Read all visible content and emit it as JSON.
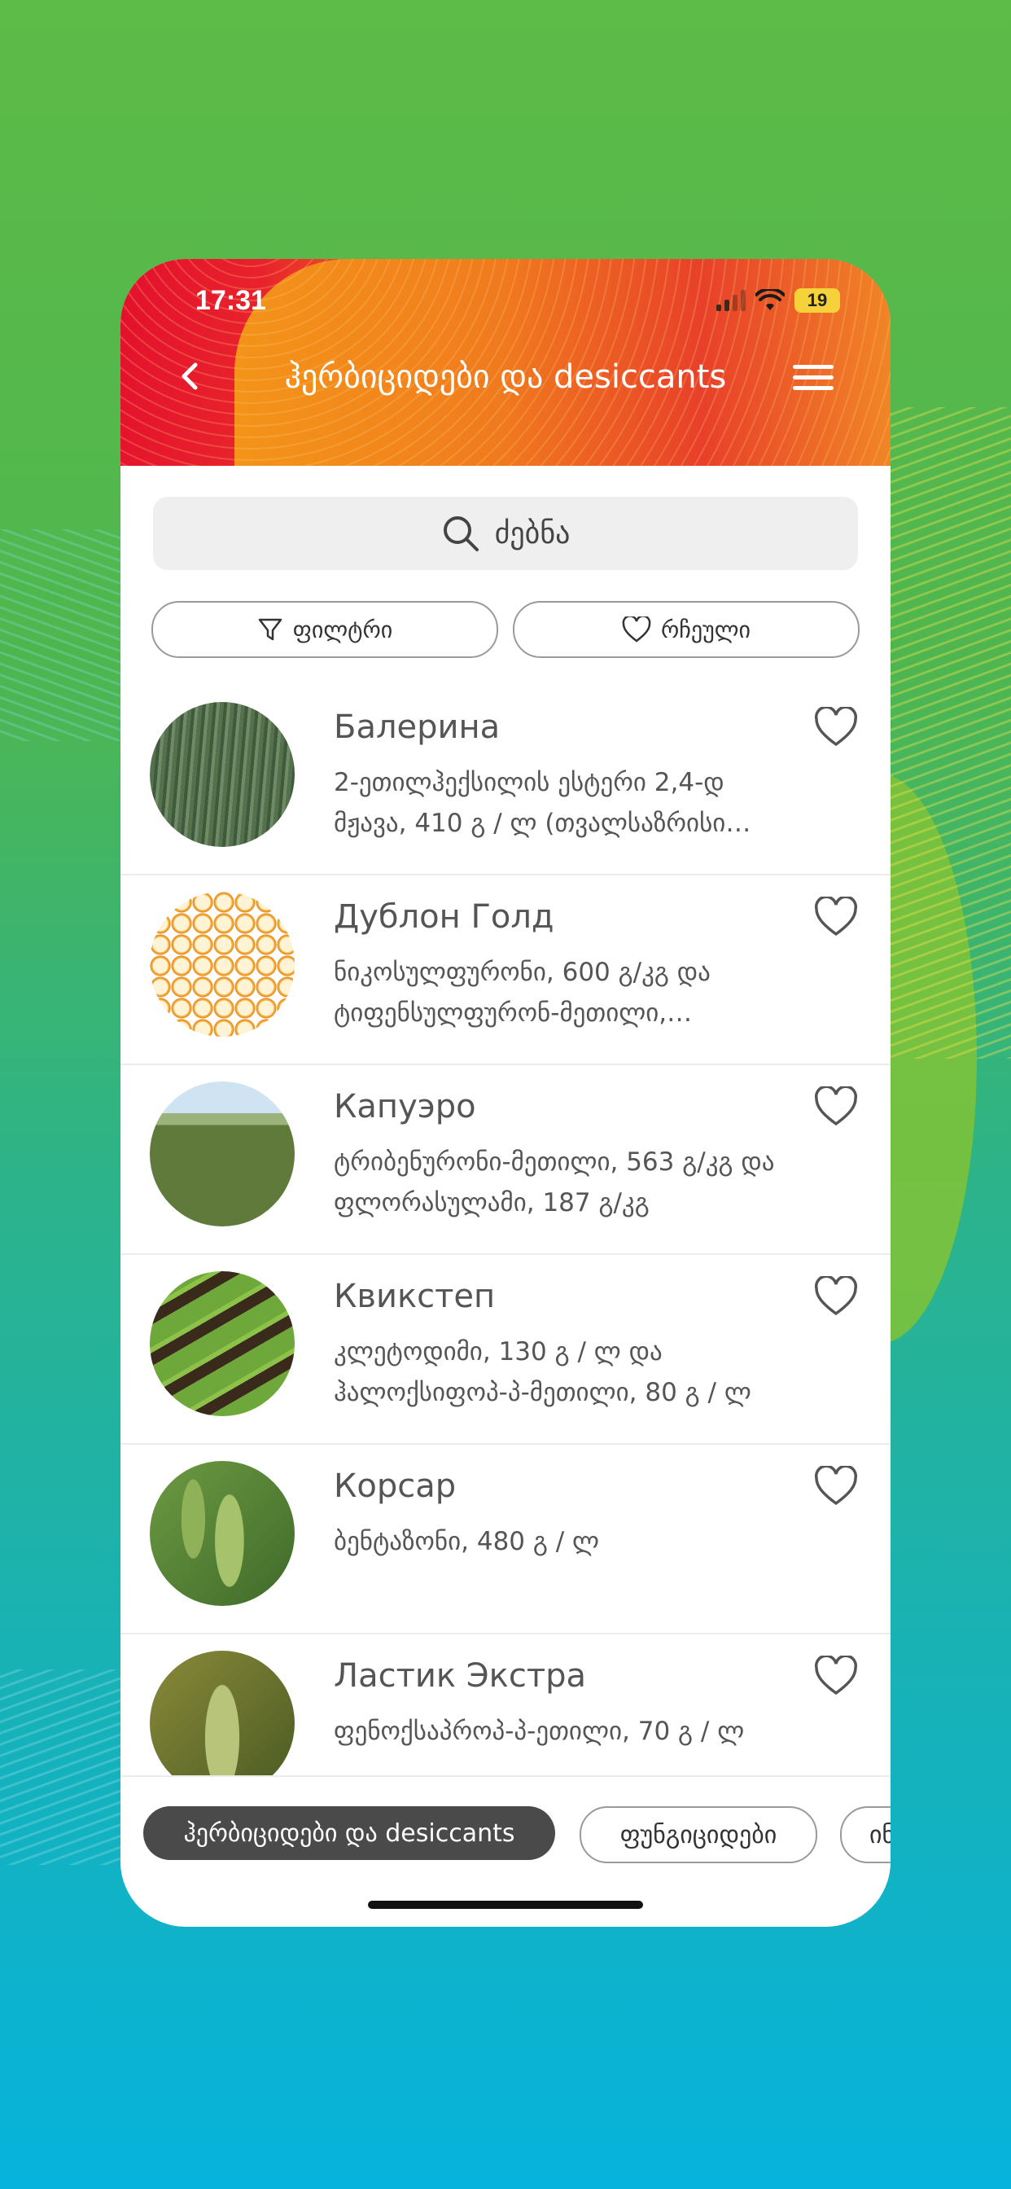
{
  "status_bar": {
    "time": "17:31",
    "battery": "19"
  },
  "header": {
    "title": "ჰერბიციდები და desiccants"
  },
  "search": {
    "placeholder": "ძებნა"
  },
  "filters": {
    "filter_label": "ფილტრი",
    "favorites_label": "რჩეული"
  },
  "products": [
    {
      "name": "Балерина",
      "description": "2-ეთილჰექსილის ესტერი 2,4-დ მჟავა, 410 გ / ლ (თვალსაზრისი…",
      "image": "wheat-field"
    },
    {
      "name": "Дублон Голд",
      "description": "ნიკოსულფურონი, 600 გ/კგ და ტიფენსულფურონ-მეთილი,…",
      "image": "corn-kernels"
    },
    {
      "name": "Капуэро",
      "description": "ტრიბენურონი-მეთილი, 563 გ/კგ და ფლორასულამი, 187 გ/კგ",
      "image": "grain-field-sky"
    },
    {
      "name": "Квикстеп",
      "description": "კლეტოდიმი, 130 გ / ლ და ჰალოქსიფოპ-პ-მეთილი, 80 გ / ლ",
      "image": "crop-rows"
    },
    {
      "name": "Корсар",
      "description": "ბენტაზონი, 480 გ / ლ",
      "image": "soybean-pods"
    },
    {
      "name": "Ластик Экстра",
      "description": "ფენოქსაპროპ-პ-ეთილი, 70 გ / ლ",
      "image": "wheat-ears"
    }
  ],
  "category_tabs": [
    {
      "label": "ჰერბიციდები და desiccants",
      "active": true
    },
    {
      "label": "ფუნგიციდები",
      "active": false
    },
    {
      "label": "ინ",
      "active": false
    }
  ],
  "colors": {
    "header_red": "#e3102d",
    "header_orange": "#f49a18",
    "active_tab": "#4a4a4a"
  }
}
